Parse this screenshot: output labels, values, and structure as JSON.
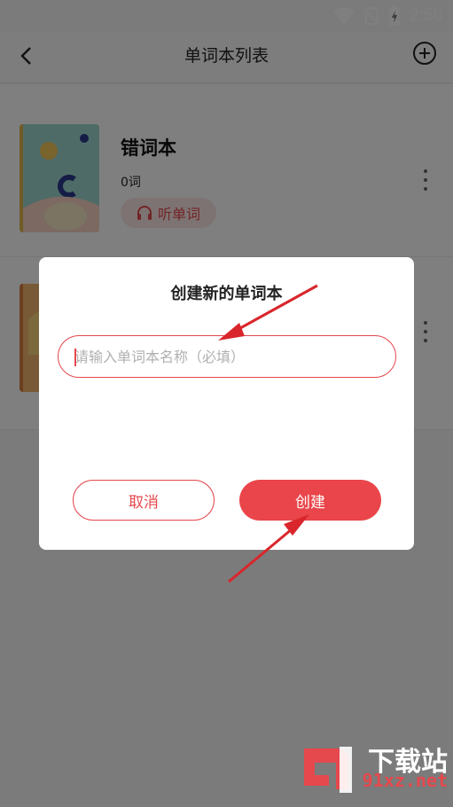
{
  "status_bar": {
    "time": "2:56",
    "icons": [
      "wifi-icon",
      "no-sim-icon",
      "battery-charging-icon"
    ]
  },
  "header": {
    "title": "单词本列表",
    "back_icon": "back-arrow-icon",
    "add_icon": "add-circle-icon"
  },
  "books": [
    {
      "name": "错词本",
      "count": "0词",
      "listen_label": "听单词"
    },
    {
      "name": "",
      "count": "",
      "listen_label": ""
    }
  ],
  "dialog": {
    "title": "创建新的单词本",
    "input_value": "",
    "input_placeholder": "请输入单词本名称（必填）",
    "cancel_label": "取消",
    "create_label": "创建"
  },
  "watermark": {
    "brand": "下载站",
    "domain": "91xz.net"
  },
  "colors": {
    "accent": "#e9454a",
    "accent_light": "#fde7e7",
    "overlay": "rgba(0,0,0,0.5)"
  }
}
